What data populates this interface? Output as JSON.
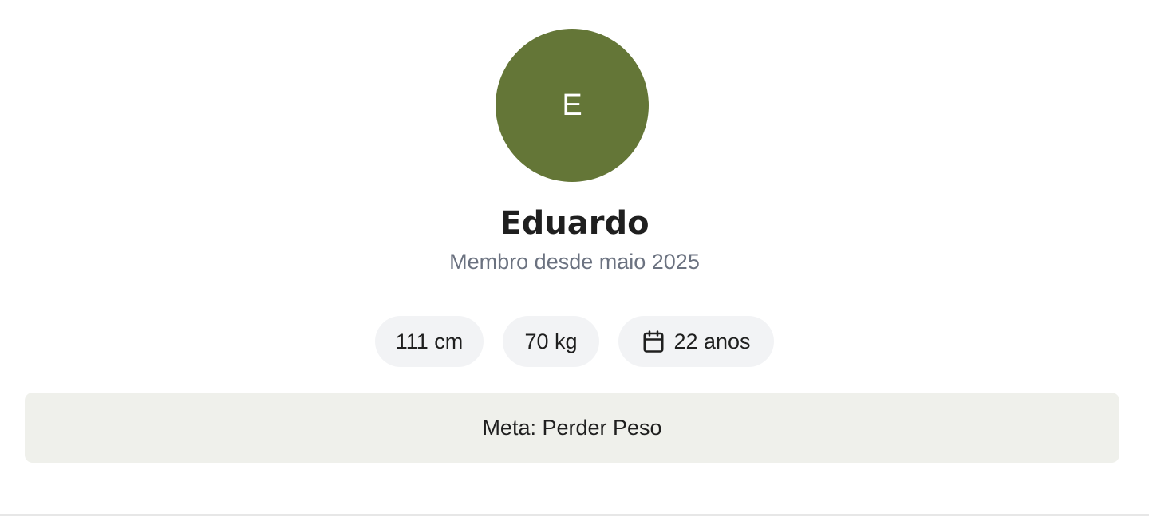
{
  "profile": {
    "initial": "E",
    "name": "Eduardo",
    "member_since": "Membro desde maio 2025",
    "avatar_color": "#647637"
  },
  "stats": {
    "height": "111 cm",
    "weight": "70 kg",
    "age": "22 anos",
    "age_icon": "calendar-icon"
  },
  "goal": {
    "text": "Meta: Perder Peso"
  }
}
